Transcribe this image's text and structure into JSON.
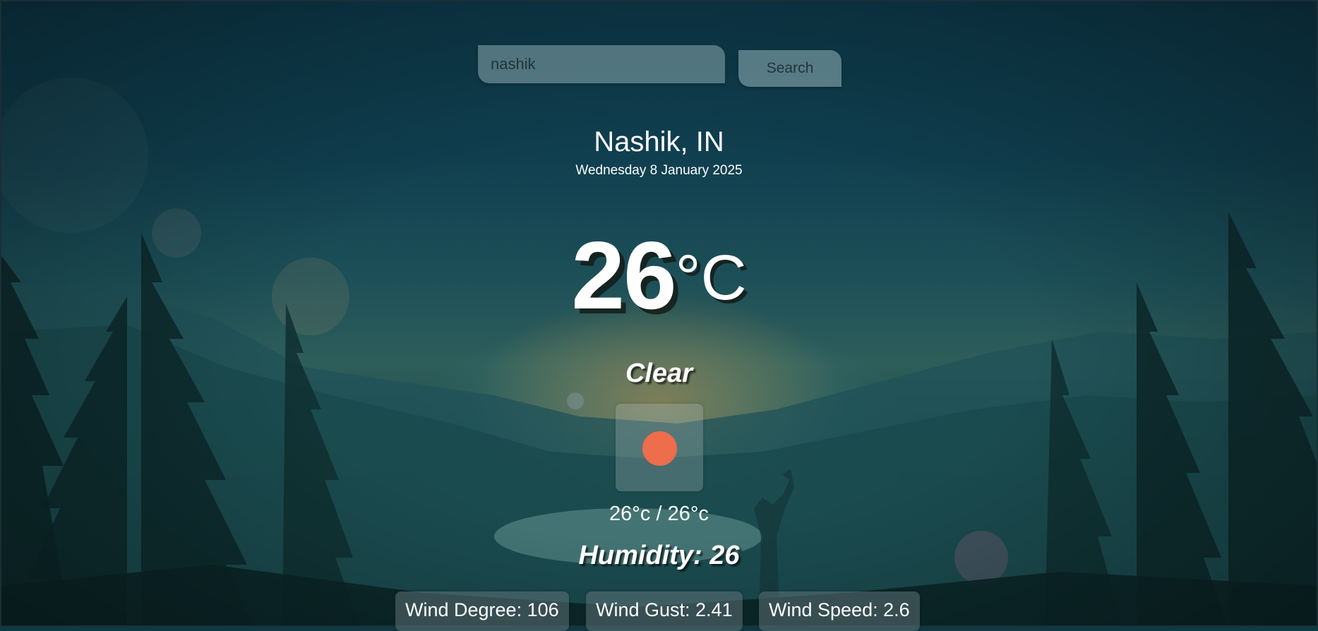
{
  "search": {
    "value": "nashik",
    "button_label": "Search"
  },
  "location": {
    "city_country": "Nashik, IN",
    "date": "Wednesday 8 January 2025"
  },
  "weather": {
    "temperature": "26",
    "unit": "°C",
    "condition": "Clear",
    "icon": "clear-sun-icon",
    "min_max": "26°c / 26°c",
    "humidity_label": "Humidity: 26"
  },
  "stats": {
    "wind_degree": "Wind Degree: 106",
    "wind_gust": "Wind Gust: 2.41",
    "wind_speed": "Wind Speed: 2.6"
  },
  "colors": {
    "sun": "#ed6d4d",
    "background": "#0f3a44"
  }
}
